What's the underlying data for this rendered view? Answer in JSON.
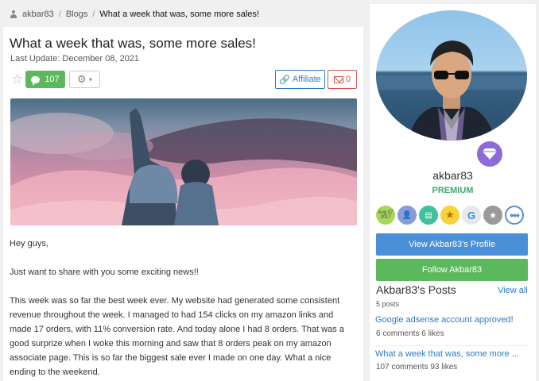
{
  "breadcrumb": {
    "user": "akbar83",
    "section": "Blogs",
    "current": "What a week that was, some more sales!",
    "separator": "/"
  },
  "post": {
    "title": "What a week that was, some more sales!",
    "last_update": "Last Update: December 08, 2021",
    "likes": "107",
    "affiliate_label": "Affiliate",
    "messages": "0",
    "paragraphs": [
      "Hey guys,",
      "Just want to share with you some exciting news!!",
      "This week was so far the best week ever. My website had generated some consistent revenue throughout the week. I managed to had 154 clicks on my amazon links and made 17 orders, with 11% conversion rate. And today alone I had 8 orders. That was a good surprize when I woke this morning and saw that 8 orders peak on my amazon associate page. This is so far the biggest sale ever I made on one day. What a nice ending to the weekend."
    ]
  },
  "sidebar": {
    "username": "akbar83",
    "tier": "PREMIUM",
    "badge_date": [
      "Aug 07",
      "2017"
    ],
    "badge_more": "•••",
    "view_profile": "View Akbar83's Profile",
    "follow": "Follow Akbar83",
    "posts_heading": "Akbar83's Posts",
    "view_all": "View all",
    "posts_count": "5 posts",
    "posts": [
      {
        "title": "Google adsense account approved!",
        "meta": "6 comments   6 likes"
      },
      {
        "title": "What a week that was, some more ...",
        "meta": "107 comments   93 likes"
      }
    ]
  },
  "colors": {
    "accent_blue": "#4a90d9",
    "accent_green": "#5cb85c",
    "link": "#2d7bc4",
    "danger": "#d9534f",
    "premium": "#3aaa6a"
  },
  "icons": [
    "user-icon",
    "star-icon",
    "comment-icon",
    "gear-icon",
    "chevron-down-icon",
    "link-icon",
    "envelope-icon",
    "gem-icon",
    "more-icon"
  ]
}
